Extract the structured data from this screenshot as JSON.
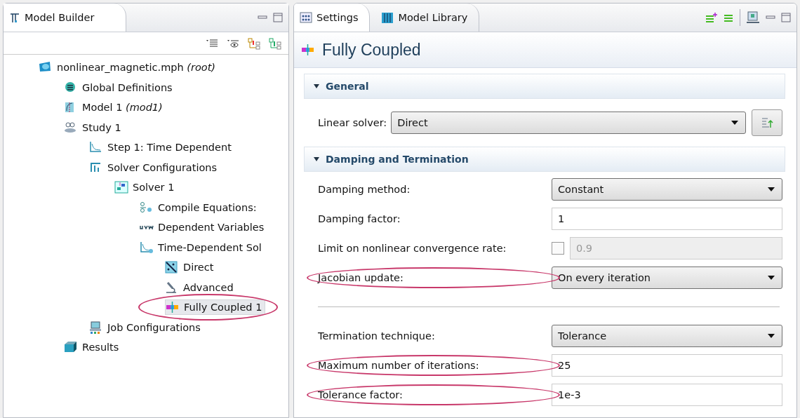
{
  "model_builder": {
    "title": "Model Builder",
    "tree": [
      {
        "label": "nonlinear_magnetic.mph *(root)*",
        "selected": false,
        "children": [
          {
            "label": "Global Definitions",
            "selected": false
          },
          {
            "label": "Model 1 *(mod1)*",
            "selected": false
          },
          {
            "label": "Study 1",
            "selected": false,
            "children": [
              {
                "label": "Step 1: Time Dependent",
                "selected": false
              },
              {
                "label": "Solver Configurations",
                "selected": false,
                "children": [
                  {
                    "label": "Solver 1",
                    "selected": false,
                    "children": [
                      {
                        "label": "Compile Equations:",
                        "selected": false
                      },
                      {
                        "label": "Dependent Variables",
                        "selected": false
                      },
                      {
                        "label": "Time-Dependent Sol",
                        "selected": false,
                        "children": [
                          {
                            "label": "Direct",
                            "selected": false
                          },
                          {
                            "label": "Advanced",
                            "selected": false
                          },
                          {
                            "label": "Fully Coupled 1",
                            "selected": true,
                            "circled": true
                          }
                        ]
                      }
                    ]
                  }
                ]
              },
              {
                "label": "Job Configurations",
                "selected": false
              }
            ]
          },
          {
            "label": "Results",
            "selected": false
          }
        ]
      }
    ]
  },
  "settings": {
    "tabs": [
      {
        "label": "Settings",
        "selected": true
      },
      {
        "label": "Model Library",
        "selected": false
      }
    ],
    "title": "Fully Coupled",
    "sections": [
      {
        "title": "General",
        "expanded": true,
        "rows": [
          {
            "kind": "select-button",
            "label": "Linear solver:",
            "value": "Direct"
          }
        ]
      },
      {
        "title": "Damping and Termination",
        "expanded": true,
        "rows": [
          {
            "kind": "select",
            "label": "Damping method:",
            "value": "Constant"
          },
          {
            "kind": "text",
            "label": "Damping factor:",
            "value": "1"
          },
          {
            "kind": "check-text",
            "label": "Limit on nonlinear convergence rate:",
            "checked": false,
            "value": "0.9"
          },
          {
            "kind": "select",
            "label": "Jacobian update:",
            "value": "On every iteration",
            "circled": true
          },
          {
            "kind": "separator"
          },
          {
            "kind": "select",
            "label": "Termination technique:",
            "value": "Tolerance"
          },
          {
            "kind": "text",
            "label": "Maximum number of iterations:",
            "value": "25",
            "circled": true
          },
          {
            "kind": "text",
            "label": "Tolerance factor:",
            "value": "1e-3",
            "circled": true
          }
        ]
      }
    ]
  }
}
